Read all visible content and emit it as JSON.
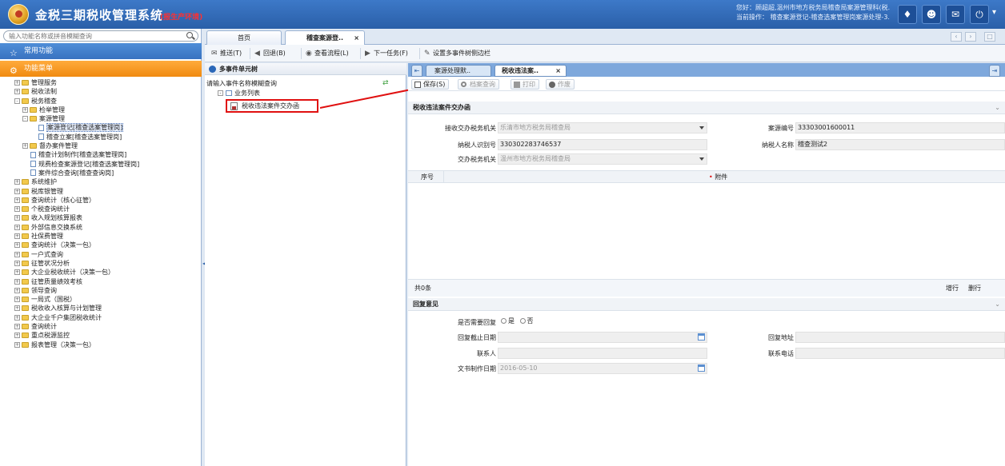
{
  "app": {
    "title": "金税三期税收管理系统",
    "env_tag": "(报生产环境)",
    "user_line1": "您好：顾超超,温州市地方税务局稽查局案源管理科(税.",
    "user_line2": "当前操作： 稽查案源登记-稽查选案管理岗案源处理-3."
  },
  "sidebar": {
    "search_placeholder": "输入功能名称或拼音模糊查询",
    "common_label": "常用功能",
    "menu_label": "功能菜单",
    "tree": [
      {
        "label": "管理服务",
        "depth": 0,
        "type": "folder",
        "open": false
      },
      {
        "label": "税收法制",
        "depth": 0,
        "type": "folder",
        "open": false
      },
      {
        "label": "税务稽查",
        "depth": 0,
        "type": "folder",
        "open": true
      },
      {
        "label": "检举管理",
        "depth": 1,
        "type": "folder",
        "open": false
      },
      {
        "label": "案源管理",
        "depth": 1,
        "type": "folder",
        "open": true
      },
      {
        "label": "案源登记[稽查选案管理岗]",
        "depth": 2,
        "type": "page",
        "selected": true
      },
      {
        "label": "稽查立案[稽查选案管理岗]",
        "depth": 2,
        "type": "page"
      },
      {
        "label": "督办案件管理",
        "depth": 1,
        "type": "folder",
        "open": false
      },
      {
        "label": "稽查计划制作[稽查选案管理岗]",
        "depth": 1,
        "type": "page"
      },
      {
        "label": "规费检查案源登记[稽查选案管理岗]",
        "depth": 1,
        "type": "page"
      },
      {
        "label": "案件综合查询[稽查查询岗]",
        "depth": 1,
        "type": "page"
      },
      {
        "label": "系统维护",
        "depth": 0,
        "type": "folder",
        "open": false
      },
      {
        "label": "税库银管理",
        "depth": 0,
        "type": "folder",
        "open": false
      },
      {
        "label": "查询统计（核心征管）",
        "depth": 0,
        "type": "folder",
        "open": false
      },
      {
        "label": "个税查询统计",
        "depth": 0,
        "type": "folder",
        "open": false
      },
      {
        "label": "收入规划核算报表",
        "depth": 0,
        "type": "folder",
        "open": false
      },
      {
        "label": "外部信息交换系统",
        "depth": 0,
        "type": "folder",
        "open": false
      },
      {
        "label": "社保费管理",
        "depth": 0,
        "type": "folder",
        "open": false
      },
      {
        "label": "查询统计（决策一包）",
        "depth": 0,
        "type": "folder",
        "open": false
      },
      {
        "label": "一户式查询",
        "depth": 0,
        "type": "folder",
        "open": false
      },
      {
        "label": "征管状况分析",
        "depth": 0,
        "type": "folder",
        "open": false
      },
      {
        "label": "大企业税收统计（决策一包）",
        "depth": 0,
        "type": "folder",
        "open": false
      },
      {
        "label": "征管质量绩效考核",
        "depth": 0,
        "type": "folder",
        "open": false
      },
      {
        "label": "领导查询",
        "depth": 0,
        "type": "folder",
        "open": false
      },
      {
        "label": "一局式（国税）",
        "depth": 0,
        "type": "folder",
        "open": false
      },
      {
        "label": "税收收入核算与计划管理",
        "depth": 0,
        "type": "folder",
        "open": false
      },
      {
        "label": "大企业千户集团税收统计",
        "depth": 0,
        "type": "folder",
        "open": false
      },
      {
        "label": "查询统计",
        "depth": 0,
        "type": "folder",
        "open": false
      },
      {
        "label": "重点税源监控",
        "depth": 0,
        "type": "folder",
        "open": false
      },
      {
        "label": "报表管理（决策一包）",
        "depth": 0,
        "type": "folder",
        "open": false
      }
    ]
  },
  "tabs": {
    "home": "首页",
    "case": "稽查案源登..",
    "close": "×"
  },
  "toolbar": {
    "push": "推送(T)",
    "back": "回退(B)",
    "flow": "查看流程(L)",
    "next": "下一任务(F)",
    "setside": "设置多事件树侧边栏"
  },
  "event_tree": {
    "title": "多事件单元树",
    "prompt": "请输入事件名称模糊查询",
    "list_label": "业务列表",
    "item": "税收违法案件交办函"
  },
  "form": {
    "tab_proc": "案源处理默..",
    "tab_cur": "税收违法案..",
    "tab_close": "×",
    "btn_save": "保存(S)",
    "btn_archive": "档案查询",
    "btn_print": "打印",
    "btn_void": "作废",
    "section_doc": "税收违法案件交办函",
    "fields": {
      "recv_org_label": "接收交办税务机关",
      "recv_org_value": "乐清市地方税务局稽查局",
      "case_no_label": "案源编号",
      "case_no_value": "33303001600011",
      "taxpayer_id_label": "纳税人识别号",
      "taxpayer_id_value": "330302283746537",
      "taxpayer_name_label": "纳税人名称",
      "taxpayer_name_value": "稽查测试2",
      "assign_org_label": "交办税务机关",
      "assign_org_value": "温州市地方税务局稽查局"
    },
    "grid": {
      "col_no": "序号",
      "col_att_req": "•",
      "col_att": "附件",
      "count": "共0条",
      "add_row": "增行",
      "del_row": "删行"
    },
    "section_reply": "回复意见",
    "reply": {
      "need_reply_label": "是否需要回复",
      "opt_yes": "是",
      "opt_no": "否",
      "deadline_label": "回复截止日期",
      "address_label": "回复地址",
      "contact_label": "联系人",
      "phone_label": "联系电话",
      "doc_date_label": "文书制作日期",
      "doc_date_value": "2016-05-10"
    }
  }
}
